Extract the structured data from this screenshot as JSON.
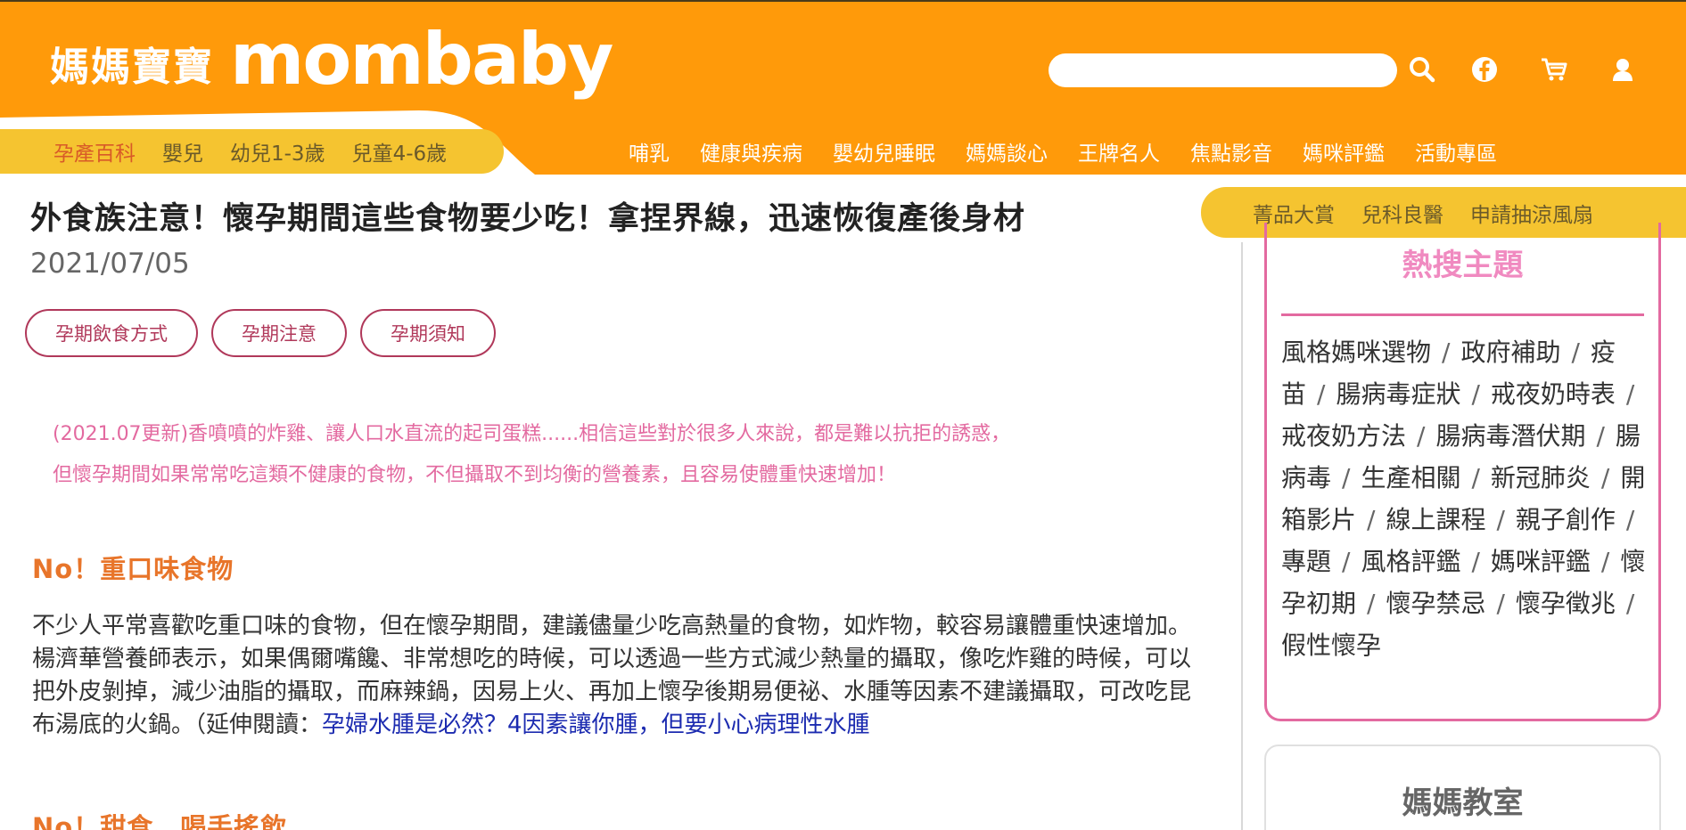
{
  "brand": {
    "name_cn": "媽媽寶寶",
    "name_en": "mombaby",
    "primary_color": "#ff9a0a",
    "accent_yellow": "#f5c430"
  },
  "header": {
    "search_placeholder": "",
    "icons": [
      "search-icon",
      "facebook-icon",
      "cart-icon",
      "user-icon"
    ]
  },
  "subnav": [
    "孕產百科",
    "嬰兒",
    "幼兒1-3歲",
    "兒童4-6歲"
  ],
  "mainnav": [
    "哺乳",
    "健康與疾病",
    "嬰幼兒睡眠",
    "媽媽談心",
    "王牌名人",
    "焦點影音",
    "媽咪評鑑",
    "活動專區"
  ],
  "side_tabs": [
    "菁品大賞",
    "兒科良醫",
    "申請抽涼風扇"
  ],
  "article": {
    "title": "外食族注意！懷孕期間這些食物要少吃！拿捏界線，迅速恢復產後身材",
    "date": "2021/07/05",
    "tags": [
      "孕期飲食方式",
      "孕期注意",
      "孕期須知"
    ],
    "intro_line1": "(2021.07更新)香噴噴的炸雞、讓人口水直流的起司蛋糕......相信這些對於很多人來說，都是難以抗拒的誘惑，",
    "intro_line2": "但懷孕期間如果常常吃這類不健康的食物，不但攝取不到均衡的營養素，且容易使體重快速增加！",
    "section1_heading": "No！重口味食物",
    "section1_body": "不少人平常喜歡吃重口味的食物，但在懷孕期間，建議儘量少吃高熱量的食物，如炸物，較容易讓體重快速增加。楊濟華營養師表示，如果偶爾嘴饞、非常想吃的時候，可以透過一些方式減少熱量的攝取，像吃炸雞的時候，可以把外皮剝掉，減少油脂的攝取，而麻辣鍋，因易上火、再加上懷孕後期易便祕、水腫等因素不建議攝取，可改吃昆布湯底的火鍋。（延伸閱讀：",
    "section1_link": "孕婦水腫是必然？4因素讓你腫，但要小心病理性水腫",
    "section2_heading": "No！甜食、喝手搖飲"
  },
  "sidebar": {
    "hot_title": "熱搜主題",
    "hot_topics": [
      "風格媽咪選物",
      "政府補助",
      "疫苗",
      "腸病毒症狀",
      "戒夜奶時表",
      "戒夜奶方法",
      "腸病毒潛伏期",
      "腸病毒",
      "生產相關",
      "新冠肺炎",
      "開箱影片",
      "線上課程",
      "親子創作",
      "專題",
      "風格評鑑",
      "媽咪評鑑",
      "懷孕初期",
      "懷孕禁忌",
      "懷孕徵兆",
      "假性懷孕"
    ],
    "class_title": "媽媽教室"
  }
}
